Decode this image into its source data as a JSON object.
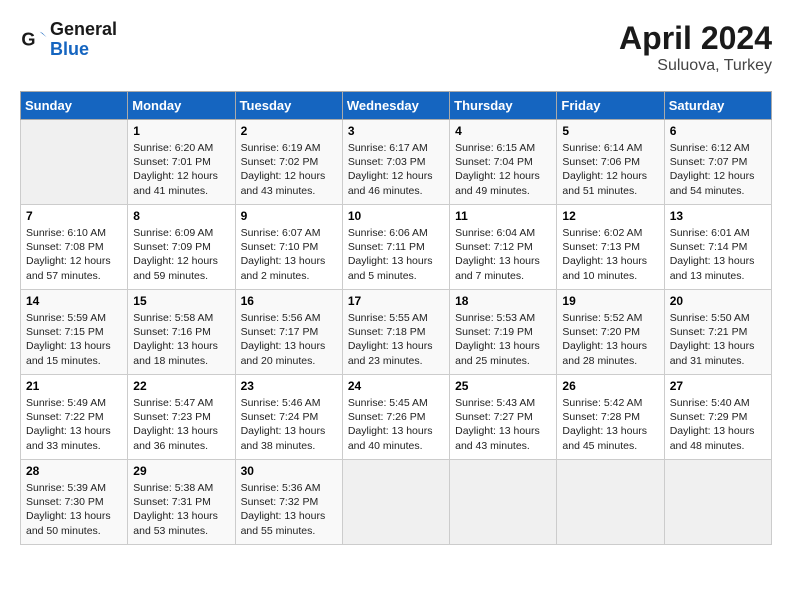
{
  "header": {
    "logo_line1": "General",
    "logo_line2": "Blue",
    "title": "April 2024",
    "subtitle": "Suluova, Turkey"
  },
  "days_of_week": [
    "Sunday",
    "Monday",
    "Tuesday",
    "Wednesday",
    "Thursday",
    "Friday",
    "Saturday"
  ],
  "weeks": [
    [
      {
        "day": "",
        "info": ""
      },
      {
        "day": "1",
        "info": "Sunrise: 6:20 AM\nSunset: 7:01 PM\nDaylight: 12 hours\nand 41 minutes."
      },
      {
        "day": "2",
        "info": "Sunrise: 6:19 AM\nSunset: 7:02 PM\nDaylight: 12 hours\nand 43 minutes."
      },
      {
        "day": "3",
        "info": "Sunrise: 6:17 AM\nSunset: 7:03 PM\nDaylight: 12 hours\nand 46 minutes."
      },
      {
        "day": "4",
        "info": "Sunrise: 6:15 AM\nSunset: 7:04 PM\nDaylight: 12 hours\nand 49 minutes."
      },
      {
        "day": "5",
        "info": "Sunrise: 6:14 AM\nSunset: 7:06 PM\nDaylight: 12 hours\nand 51 minutes."
      },
      {
        "day": "6",
        "info": "Sunrise: 6:12 AM\nSunset: 7:07 PM\nDaylight: 12 hours\nand 54 minutes."
      }
    ],
    [
      {
        "day": "7",
        "info": "Sunrise: 6:10 AM\nSunset: 7:08 PM\nDaylight: 12 hours\nand 57 minutes."
      },
      {
        "day": "8",
        "info": "Sunrise: 6:09 AM\nSunset: 7:09 PM\nDaylight: 12 hours\nand 59 minutes."
      },
      {
        "day": "9",
        "info": "Sunrise: 6:07 AM\nSunset: 7:10 PM\nDaylight: 13 hours\nand 2 minutes."
      },
      {
        "day": "10",
        "info": "Sunrise: 6:06 AM\nSunset: 7:11 PM\nDaylight: 13 hours\nand 5 minutes."
      },
      {
        "day": "11",
        "info": "Sunrise: 6:04 AM\nSunset: 7:12 PM\nDaylight: 13 hours\nand 7 minutes."
      },
      {
        "day": "12",
        "info": "Sunrise: 6:02 AM\nSunset: 7:13 PM\nDaylight: 13 hours\nand 10 minutes."
      },
      {
        "day": "13",
        "info": "Sunrise: 6:01 AM\nSunset: 7:14 PM\nDaylight: 13 hours\nand 13 minutes."
      }
    ],
    [
      {
        "day": "14",
        "info": "Sunrise: 5:59 AM\nSunset: 7:15 PM\nDaylight: 13 hours\nand 15 minutes."
      },
      {
        "day": "15",
        "info": "Sunrise: 5:58 AM\nSunset: 7:16 PM\nDaylight: 13 hours\nand 18 minutes."
      },
      {
        "day": "16",
        "info": "Sunrise: 5:56 AM\nSunset: 7:17 PM\nDaylight: 13 hours\nand 20 minutes."
      },
      {
        "day": "17",
        "info": "Sunrise: 5:55 AM\nSunset: 7:18 PM\nDaylight: 13 hours\nand 23 minutes."
      },
      {
        "day": "18",
        "info": "Sunrise: 5:53 AM\nSunset: 7:19 PM\nDaylight: 13 hours\nand 25 minutes."
      },
      {
        "day": "19",
        "info": "Sunrise: 5:52 AM\nSunset: 7:20 PM\nDaylight: 13 hours\nand 28 minutes."
      },
      {
        "day": "20",
        "info": "Sunrise: 5:50 AM\nSunset: 7:21 PM\nDaylight: 13 hours\nand 31 minutes."
      }
    ],
    [
      {
        "day": "21",
        "info": "Sunrise: 5:49 AM\nSunset: 7:22 PM\nDaylight: 13 hours\nand 33 minutes."
      },
      {
        "day": "22",
        "info": "Sunrise: 5:47 AM\nSunset: 7:23 PM\nDaylight: 13 hours\nand 36 minutes."
      },
      {
        "day": "23",
        "info": "Sunrise: 5:46 AM\nSunset: 7:24 PM\nDaylight: 13 hours\nand 38 minutes."
      },
      {
        "day": "24",
        "info": "Sunrise: 5:45 AM\nSunset: 7:26 PM\nDaylight: 13 hours\nand 40 minutes."
      },
      {
        "day": "25",
        "info": "Sunrise: 5:43 AM\nSunset: 7:27 PM\nDaylight: 13 hours\nand 43 minutes."
      },
      {
        "day": "26",
        "info": "Sunrise: 5:42 AM\nSunset: 7:28 PM\nDaylight: 13 hours\nand 45 minutes."
      },
      {
        "day": "27",
        "info": "Sunrise: 5:40 AM\nSunset: 7:29 PM\nDaylight: 13 hours\nand 48 minutes."
      }
    ],
    [
      {
        "day": "28",
        "info": "Sunrise: 5:39 AM\nSunset: 7:30 PM\nDaylight: 13 hours\nand 50 minutes."
      },
      {
        "day": "29",
        "info": "Sunrise: 5:38 AM\nSunset: 7:31 PM\nDaylight: 13 hours\nand 53 minutes."
      },
      {
        "day": "30",
        "info": "Sunrise: 5:36 AM\nSunset: 7:32 PM\nDaylight: 13 hours\nand 55 minutes."
      },
      {
        "day": "",
        "info": ""
      },
      {
        "day": "",
        "info": ""
      },
      {
        "day": "",
        "info": ""
      },
      {
        "day": "",
        "info": ""
      }
    ]
  ]
}
